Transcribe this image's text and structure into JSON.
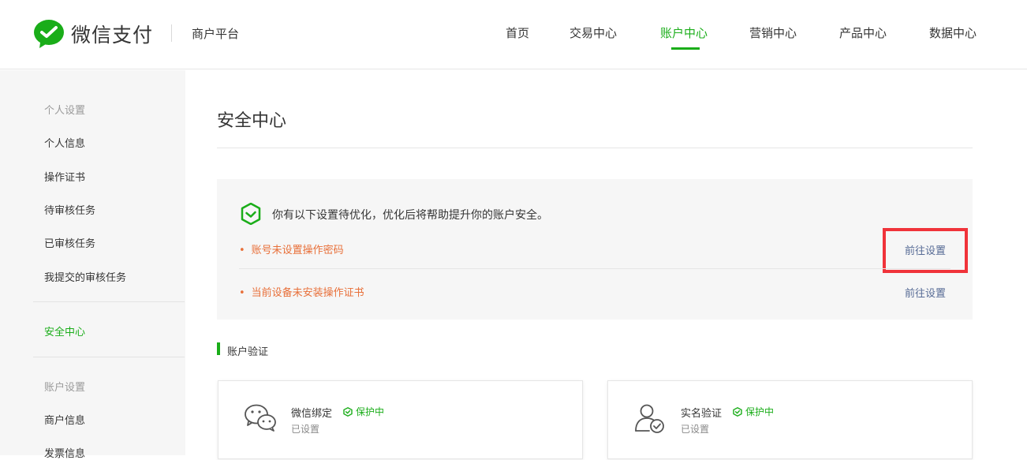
{
  "header": {
    "brand": "微信支付",
    "platform": "商户平台",
    "nav": [
      {
        "label": "首页"
      },
      {
        "label": "交易中心"
      },
      {
        "label": "账户中心"
      },
      {
        "label": "营销中心"
      },
      {
        "label": "产品中心"
      },
      {
        "label": "数据中心"
      }
    ],
    "active_nav": "账户中心",
    "accent_color": "#1aad19"
  },
  "sidebar": {
    "group1": "个人设置",
    "items1": [
      {
        "label": "个人信息"
      },
      {
        "label": "操作证书"
      },
      {
        "label": "待审核任务"
      },
      {
        "label": "已审核任务"
      },
      {
        "label": "我提交的审核任务"
      }
    ],
    "security": "安全中心",
    "group2": "账户设置",
    "items2": [
      {
        "label": "商户信息"
      },
      {
        "label": "发票信息"
      }
    ]
  },
  "main": {
    "title": "安全中心",
    "alert": {
      "message": "你有以下设置待优化，优化后将帮助提升你的账户安全。",
      "rows": [
        {
          "text": "账号未设置操作密码",
          "action": "前往设置"
        },
        {
          "text": "当前设备未安装操作证书",
          "action": "前往设置"
        }
      ],
      "warning_color": "#e8703a"
    },
    "section_title": "账户验证",
    "cards": [
      {
        "name": "微信绑定",
        "badge": "保护中",
        "status": "已设置",
        "icon": "wechat-icon"
      },
      {
        "name": "实名验证",
        "badge": "保护中",
        "status": "已设置",
        "icon": "user-verified-icon"
      }
    ]
  }
}
